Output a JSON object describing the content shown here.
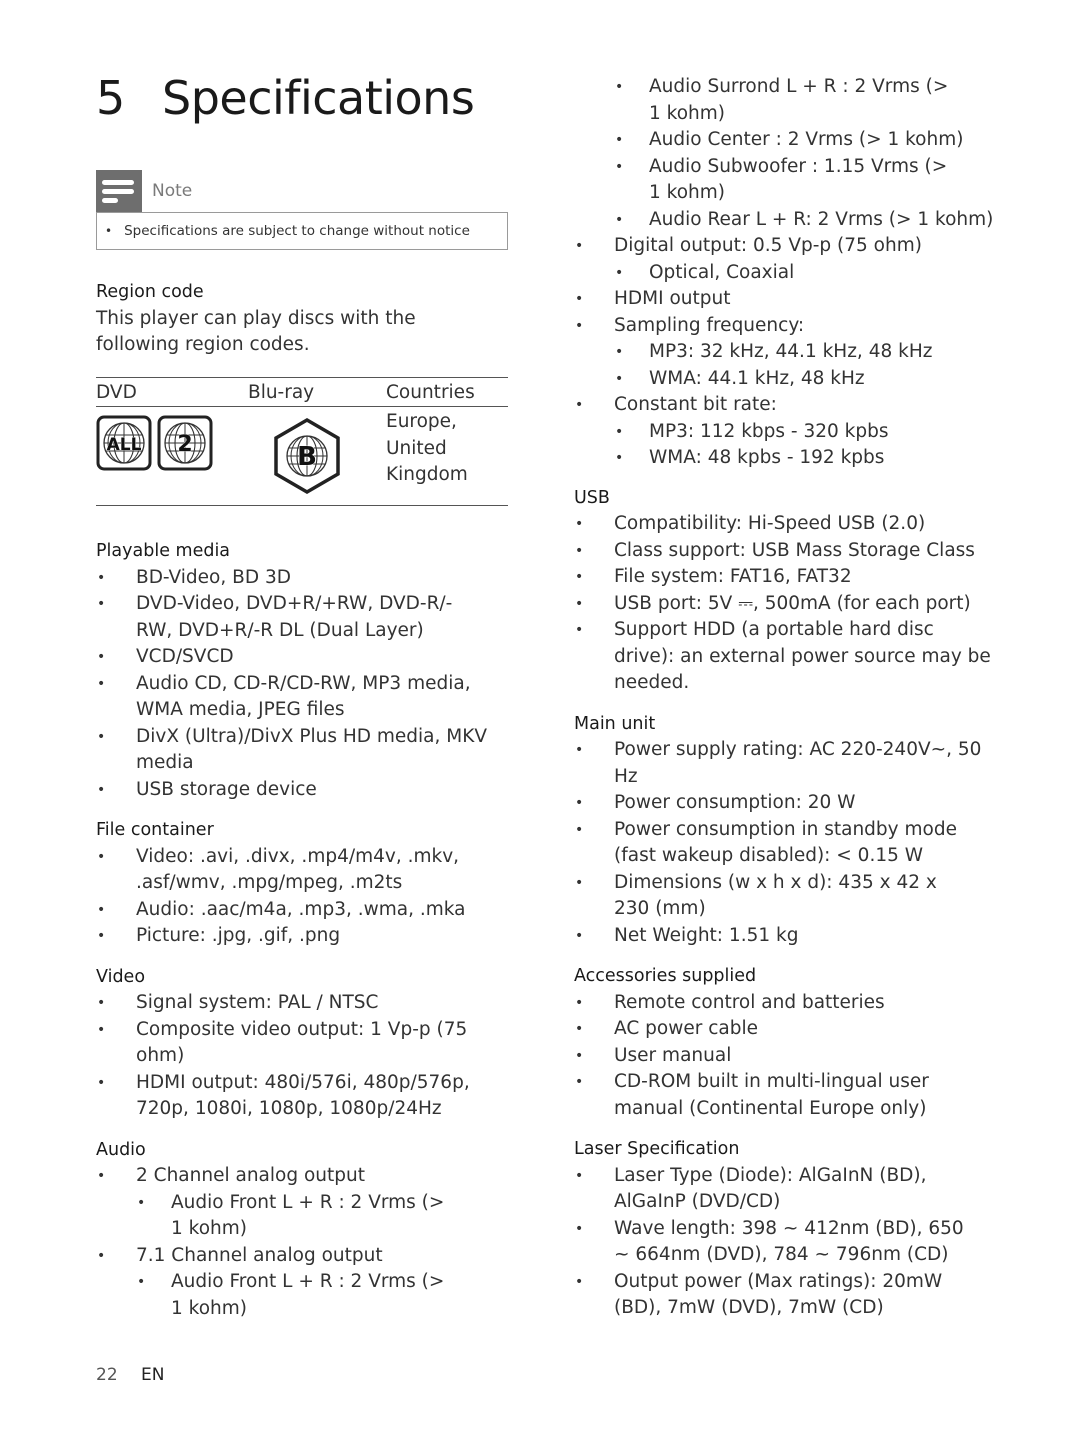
{
  "header": {
    "section_number": "5",
    "title": "Specifications"
  },
  "note": {
    "label": "Note",
    "icon": "note-icon",
    "items": [
      "Specifications are subject to change without notice"
    ]
  },
  "region": {
    "heading": "Region code",
    "description": "This player can play discs with the following region codes.",
    "table": {
      "columns": [
        "DVD",
        "Blu-ray",
        "Countries"
      ],
      "rows": [
        {
          "dvd_icons": [
            "ALL",
            "2"
          ],
          "bluray_icon": "B",
          "countries": [
            "Europe,",
            "United",
            "Kingdom"
          ]
        }
      ]
    }
  },
  "playable_media": {
    "heading": "Playable media",
    "items": [
      "BD-Video, BD 3D",
      "DVD-Video, DVD+R/+RW, DVD-R/-RW, DVD+R/-R DL (Dual Layer)",
      "VCD/SVCD",
      "Audio CD, CD-R/CD-RW, MP3 media, WMA media, JPEG files",
      "DivX (Ultra)/DivX Plus HD media, MKV media",
      "USB storage device"
    ]
  },
  "file_container": {
    "heading": "File container",
    "items": [
      "Video: .avi, .divx, .mp4/m4v, .mkv, .asf/wmv, .mpg/mpeg, .m2ts",
      "Audio: .aac/m4a, .mp3, .wma, .mka",
      "Picture: .jpg, .gif, .png"
    ]
  },
  "video": {
    "heading": "Video",
    "items": [
      "Signal system: PAL / NTSC",
      "Composite video output: 1 Vp-p (75 ohm)",
      "HDMI output: 480i/576i, 480p/576p, 720p, 1080i, 1080p, 1080p/24Hz"
    ]
  },
  "audio": {
    "heading": "Audio",
    "two_channel": {
      "label": "2 Channel analog output",
      "items": [
        "Audio Front L + R : 2 Vrms (> 1 kohm)"
      ]
    },
    "seven_one_channel": {
      "label": "7.1 Channel analog output",
      "items": [
        "Audio Front L + R : 2 Vrms (> 1 kohm)",
        "Audio Surrond L + R : 2 Vrms (> 1 kohm)",
        "Audio Center : 2 Vrms (> 1 kohm)",
        "Audio Subwoofer : 1.15 Vrms (> 1 kohm)",
        "Audio Rear L + R: 2 Vrms (> 1 kohm)"
      ]
    },
    "digital_output": {
      "label": "Digital output: 0.5 Vp-p (75 ohm)",
      "items": [
        "Optical, Coaxial"
      ]
    },
    "hdmi_output": "HDMI output",
    "sampling_frequency": {
      "label": "Sampling frequency:",
      "items": [
        "MP3: 32 kHz, 44.1 kHz, 48 kHz",
        "WMA: 44.1 kHz, 48 kHz"
      ]
    },
    "constant_bit_rate": {
      "label": "Constant bit rate:",
      "items": [
        "MP3: 112 kbps - 320 kpbs",
        "WMA: 48 kpbs - 192 kpbs"
      ]
    }
  },
  "usb": {
    "heading": "USB",
    "items": [
      "Compatibility: Hi-Speed USB (2.0)",
      "Class support: USB Mass Storage Class",
      "File system: FAT16, FAT32",
      "USB port: 5V ⎓, 500mA (for each port)",
      "Support HDD (a portable hard disc drive): an external power source may be needed."
    ]
  },
  "main_unit": {
    "heading": "Main unit",
    "items": [
      "Power supply rating: AC 220-240V~, 50 Hz",
      "Power consumption: 20 W",
      "Power consumption in standby mode (fast wakeup disabled): < 0.15 W",
      "Dimensions (w x h x d): 435 x 42 x 230 (mm)",
      "Net Weight: 1.51 kg"
    ]
  },
  "accessories": {
    "heading": "Accessories supplied",
    "items": [
      "Remote control and batteries",
      "AC power cable",
      "User manual",
      "CD-ROM built in multi-lingual user manual (Continental Europe only)"
    ]
  },
  "laser": {
    "heading": "Laser Specification",
    "items": [
      "Laser Type (Diode): AlGaInN (BD), AlGaInP (DVD/CD)",
      "Wave length: 398 ~ 412nm (BD), 650 ~ 664nm (DVD), 784 ~ 796nm (CD)",
      "Output power (Max ratings): 20mW (BD), 7mW (DVD), 7mW (CD)"
    ]
  },
  "footer": {
    "page_number": "22",
    "language": "EN"
  }
}
